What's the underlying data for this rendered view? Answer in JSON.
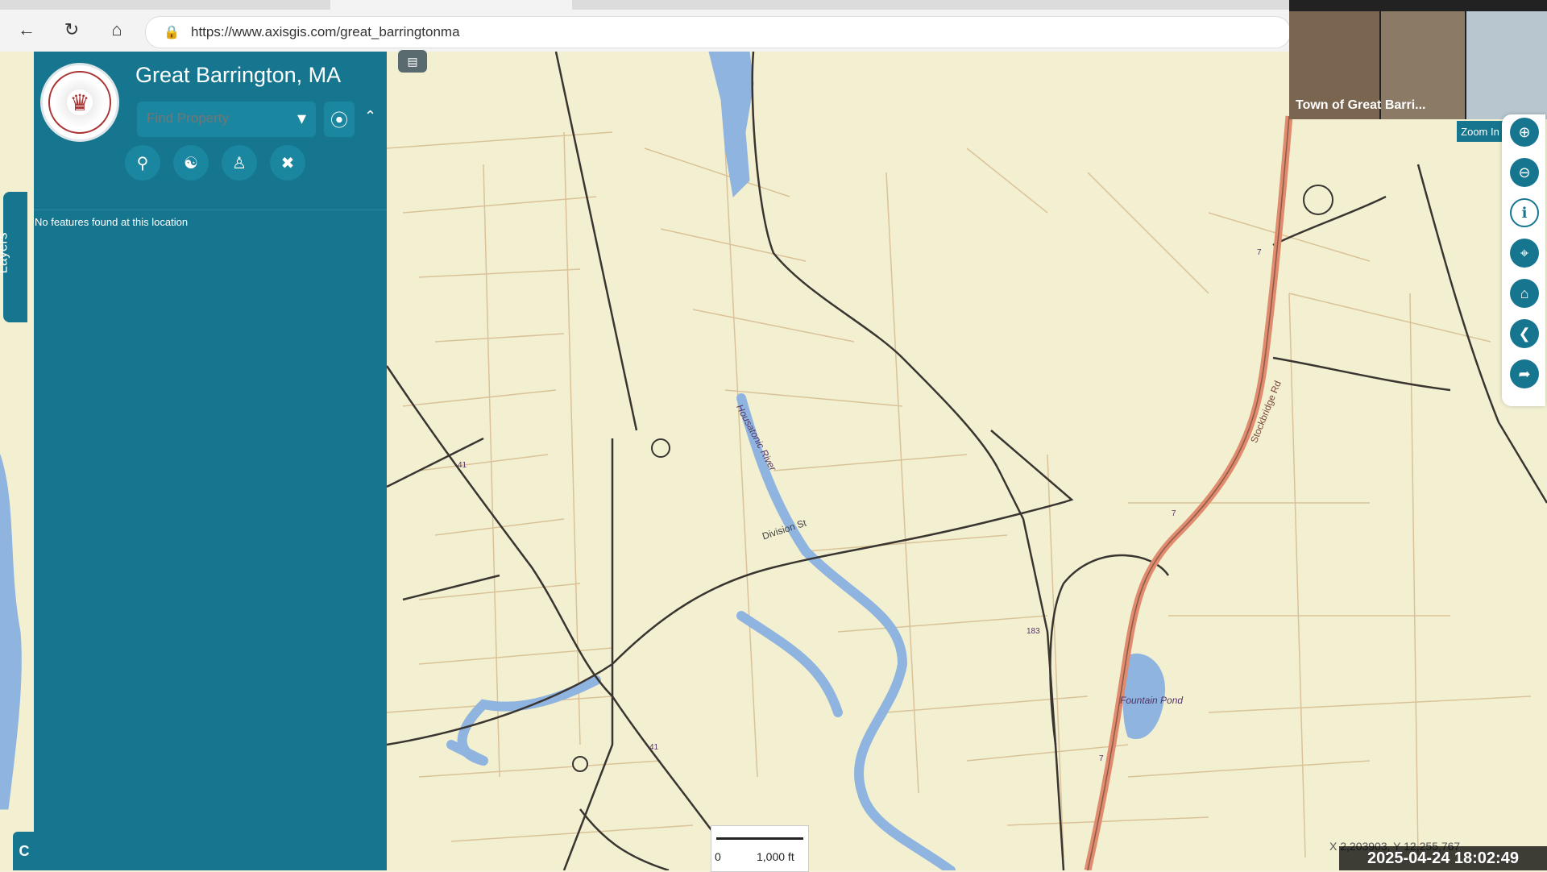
{
  "browser": {
    "url": "https://www.axisgis.com/great_barringtonma"
  },
  "app": {
    "title": "Great Barrington, MA",
    "find_placeholder": "Find Property",
    "no_features_text": "No features found at this location",
    "layers_tab_label": "Layers",
    "chat_label": "C"
  },
  "map": {
    "zoom_tooltip": "Zoom In",
    "scale_zero": "0",
    "scale_distance": "1,000 ft",
    "coordinates": "X 2,203903, Y 12,255,767",
    "labels": {
      "stockbridge_rd": "Stockbridge Rd",
      "division_st": "Division St",
      "housatonic_river": "Housatonic River",
      "fountain_pond": "Fountain Pond",
      "route_7a": "7",
      "route_7b": "7",
      "route_7c": "7",
      "route_41": "41",
      "route_183": "183",
      "route_41b": "41"
    }
  },
  "video": {
    "participant_name": "Town of Great Barri..."
  },
  "overlay": {
    "timestamp": "2025-04-24  18:02:49"
  },
  "colors": {
    "sidebar": "#16768f",
    "map_bg": "#f3f0d2",
    "parcel_line": "#d6b98a",
    "water": "#8fb4df",
    "highway": "#e08a6e"
  }
}
